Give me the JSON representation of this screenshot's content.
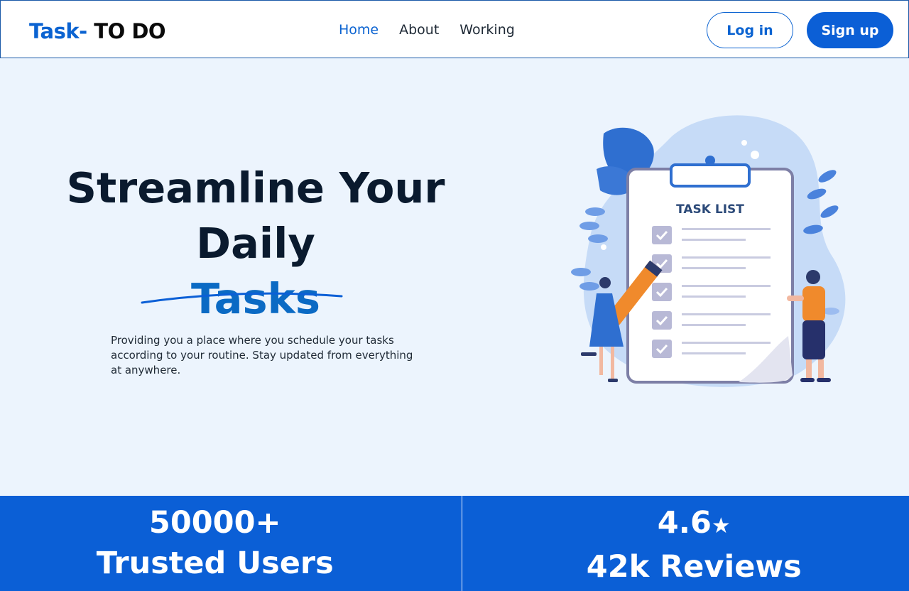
{
  "header": {
    "brand_part1": "Task-",
    "brand_part2": " TO DO",
    "nav": [
      {
        "label": "Home"
      },
      {
        "label": "About"
      },
      {
        "label": "Working"
      }
    ],
    "login_label": "Log in",
    "signup_label": "Sign up"
  },
  "hero": {
    "title_line1": "Streamline Your Daily",
    "title_line2": "Tasks",
    "description": "Providing you a place where you schedule your tasks according to your routine. Stay updated from everything at anywhere.",
    "illustration_text": "TASK LIST"
  },
  "stats": {
    "users_value": "50000+",
    "users_label": "Trusted Users",
    "rating_value": "4.6",
    "rating_star": "★",
    "reviews_label": "42k Reviews"
  },
  "colors": {
    "accent": "#0b5fd6",
    "title_accent": "#0b6ac4",
    "background": "#ecf4fd"
  }
}
